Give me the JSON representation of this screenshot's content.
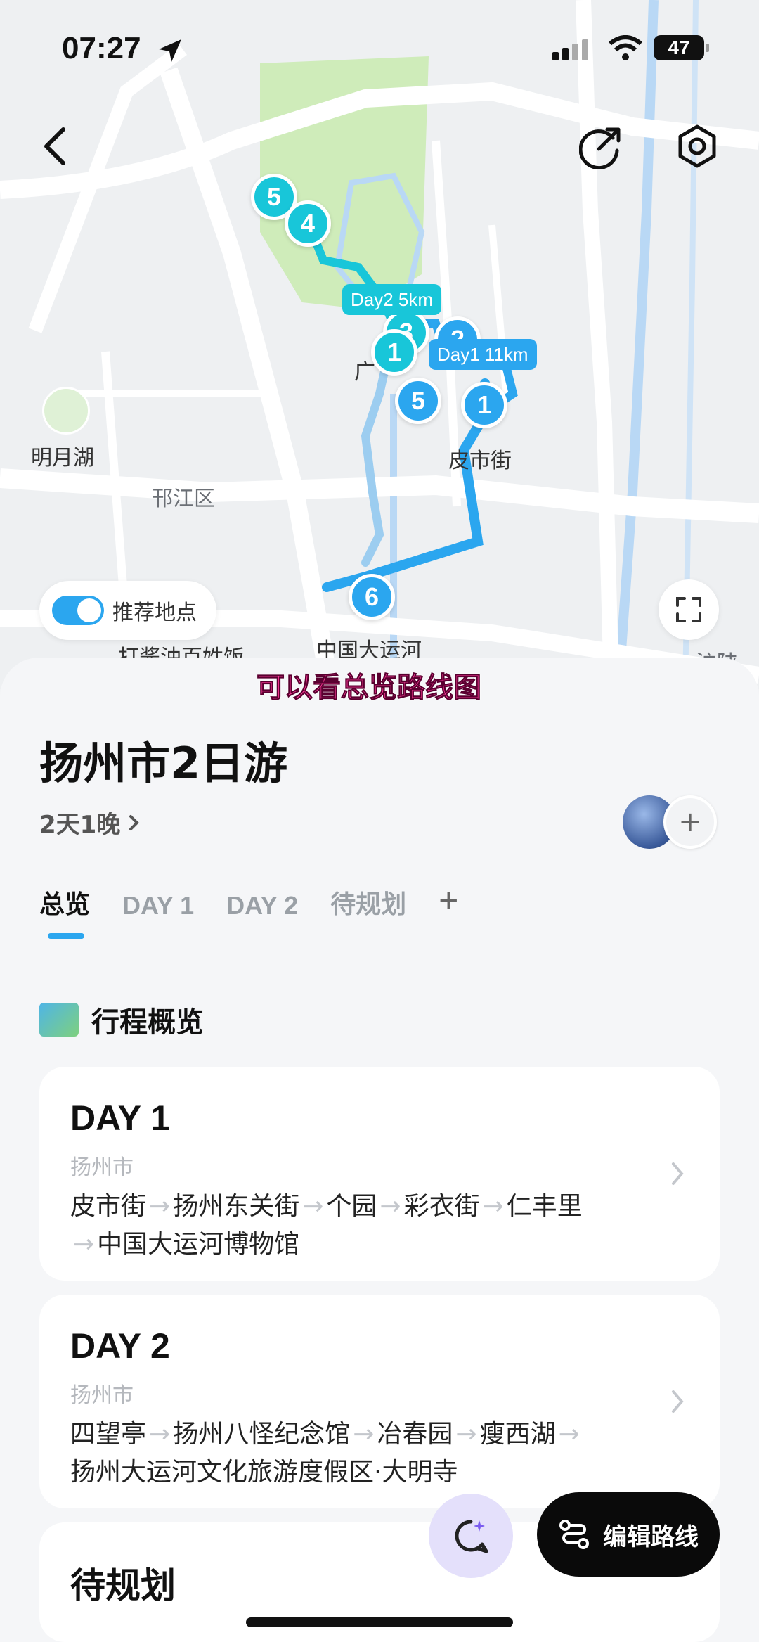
{
  "status_bar": {
    "time": "07:27",
    "battery": "47"
  },
  "map": {
    "labels": {
      "mingyue_lake": "明月湖",
      "hanjiang_district": "邗江区",
      "pishi_street": "皮市街",
      "grand_canal": "中国大运河",
      "restaurant": "打酱油百姓饭",
      "partial_road": "沪陕",
      "partial_guang": "广"
    },
    "pins": [
      "5",
      "4",
      "1",
      "5",
      "1",
      "6",
      "2",
      "3"
    ],
    "distances": {
      "day2": "Day2 5km",
      "day1": "Day1 11km"
    },
    "toggle_label": "推荐地点",
    "caption": "可以看总览路线图",
    "colors": {
      "day1": "#2ba6ef",
      "day2": "#18c6d9",
      "park": "#c9ebb0"
    }
  },
  "trip": {
    "title": "扬州市2日游",
    "duration": "2天1晚",
    "tabs": [
      "总览",
      "DAY 1",
      "DAY 2",
      "待规划",
      "+"
    ],
    "active_tab": "总览",
    "section_title": "行程概览",
    "days": [
      {
        "title": "DAY 1",
        "city": "扬州市",
        "stops": [
          "皮市街",
          "扬州东关街",
          "个园",
          "彩衣街",
          "仁丰里",
          "中国大运河博物馆"
        ]
      },
      {
        "title": "DAY 2",
        "city": "扬州市",
        "stops": [
          "四望亭",
          "扬州八怪纪念馆",
          "冶春园",
          "瘦西湖",
          "扬州大运河文化旅游度假区·大明寺"
        ]
      }
    ],
    "unplanned_title": "待规划"
  },
  "fab": {
    "edit_route": "编辑路线"
  },
  "icons": [
    "back-icon",
    "share-icon",
    "settings-icon",
    "fullscreen-icon",
    "chevron-right-icon",
    "ai-chat-icon",
    "route-icon",
    "location-arrow-icon",
    "wifi-icon",
    "signal-icon"
  ]
}
